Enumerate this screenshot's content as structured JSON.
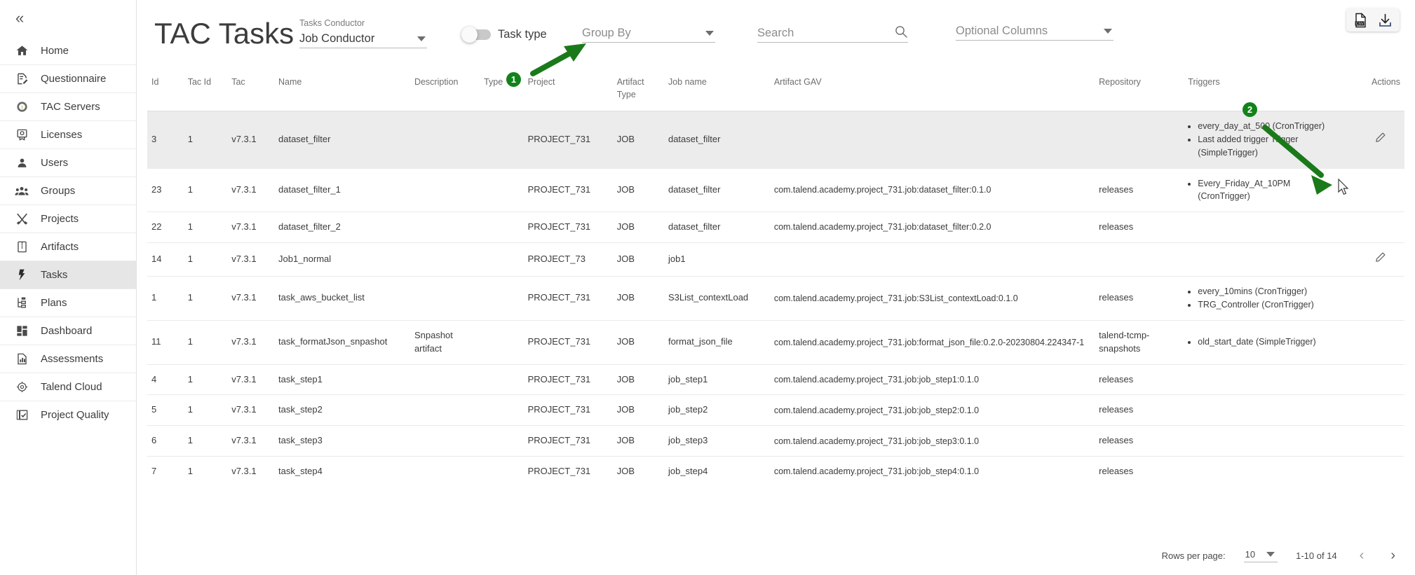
{
  "sidebar": {
    "collapse_icon": "chevrons-left-icon",
    "items": [
      {
        "label": "Home",
        "icon": "home-icon",
        "active": false
      },
      {
        "label": "Questionnaire",
        "icon": "questionnaire-icon",
        "active": false
      },
      {
        "label": "TAC Servers",
        "icon": "tac-servers-icon",
        "active": false
      },
      {
        "label": "Licenses",
        "icon": "license-icon",
        "active": false
      },
      {
        "label": "Users",
        "icon": "user-icon",
        "active": false
      },
      {
        "label": "Groups",
        "icon": "groups-icon",
        "active": false
      },
      {
        "label": "Projects",
        "icon": "projects-icon",
        "active": false
      },
      {
        "label": "Artifacts",
        "icon": "artifacts-icon",
        "active": false
      },
      {
        "label": "Tasks",
        "icon": "tasks-lightning-icon",
        "active": true
      },
      {
        "label": "Plans",
        "icon": "plans-tree-icon",
        "active": false
      },
      {
        "label": "Dashboard",
        "icon": "dashboard-icon",
        "active": false
      },
      {
        "label": "Assessments",
        "icon": "assessments-chart-icon",
        "active": false
      },
      {
        "label": "Talend Cloud",
        "icon": "talend-cloud-icon",
        "active": false
      },
      {
        "label": "Project Quality",
        "icon": "project-quality-icon",
        "active": false
      }
    ]
  },
  "header": {
    "title": "TAC Tasks",
    "conductor": {
      "label": "Tasks Conductor",
      "value": "Job Conductor"
    },
    "task_type": {
      "label": "Task type",
      "on": false
    },
    "group_by": {
      "placeholder": "Group By",
      "value": ""
    },
    "search": {
      "placeholder": "Search",
      "value": "",
      "icon": "search-icon"
    },
    "optional_columns": {
      "placeholder": "Optional Columns",
      "value": ""
    },
    "export_csv_icon": "csv-file-icon",
    "export_download_icon": "download-icon"
  },
  "table": {
    "columns": [
      "Id",
      "Tac Id",
      "Tac",
      "Name",
      "Description",
      "Type",
      "Project",
      "Artifact Type",
      "Job name",
      "Artifact GAV",
      "Repository",
      "Triggers",
      "Actions"
    ],
    "rows": [
      {
        "id": "3",
        "tac_id": "1",
        "tac": "v7.3.1",
        "name": "dataset_filter",
        "description": "",
        "type": "",
        "project": "PROJECT_731",
        "artifact_type": "JOB",
        "job_name": "dataset_filter",
        "gav": "",
        "repository": "",
        "triggers": [
          "every_day_at_500 (CronTrigger)",
          "Last added trigger Trigger (SimpleTrigger)"
        ],
        "has_edit": true,
        "selected": true
      },
      {
        "id": "23",
        "tac_id": "1",
        "tac": "v7.3.1",
        "name": "dataset_filter_1",
        "description": "",
        "type": "",
        "project": "PROJECT_731",
        "artifact_type": "JOB",
        "job_name": "dataset_filter",
        "gav": "com.talend.academy.project_731.job:dataset_filter:0.1.0",
        "repository": "releases",
        "triggers": [
          "Every_Friday_At_10PM (CronTrigger)"
        ],
        "has_edit": false,
        "selected": false
      },
      {
        "id": "22",
        "tac_id": "1",
        "tac": "v7.3.1",
        "name": "dataset_filter_2",
        "description": "",
        "type": "",
        "project": "PROJECT_731",
        "artifact_type": "JOB",
        "job_name": "dataset_filter",
        "gav": "com.talend.academy.project_731.job:dataset_filter:0.2.0",
        "repository": "releases",
        "triggers": [],
        "has_edit": false,
        "selected": false
      },
      {
        "id": "14",
        "tac_id": "1",
        "tac": "v7.3.1",
        "name": "Job1_normal",
        "description": "",
        "type": "",
        "project": "PROJECT_73",
        "artifact_type": "JOB",
        "job_name": "job1",
        "gav": "",
        "repository": "",
        "triggers": [],
        "has_edit": true,
        "selected": false
      },
      {
        "id": "1",
        "tac_id": "1",
        "tac": "v7.3.1",
        "name": "task_aws_bucket_list",
        "description": "",
        "type": "",
        "project": "PROJECT_731",
        "artifact_type": "JOB",
        "job_name": "S3List_contextLoad",
        "gav": "com.talend.academy.project_731.job:S3List_contextLoad:0.1.0",
        "repository": "releases",
        "triggers": [
          "every_10mins (CronTrigger)",
          "TRG_Controller (CronTrigger)"
        ],
        "has_edit": false,
        "selected": false
      },
      {
        "id": "11",
        "tac_id": "1",
        "tac": "v7.3.1",
        "name": "task_formatJson_snpashot",
        "description": "Snpashot artifact",
        "type": "",
        "project": "PROJECT_731",
        "artifact_type": "JOB",
        "job_name": "format_json_file",
        "gav": "com.talend.academy.project_731.job:format_json_file:0.2.0-20230804.224347-1",
        "repository": "talend-tcmp-snapshots",
        "triggers": [
          "old_start_date (SimpleTrigger)"
        ],
        "has_edit": false,
        "selected": false
      },
      {
        "id": "4",
        "tac_id": "1",
        "tac": "v7.3.1",
        "name": "task_step1",
        "description": "",
        "type": "",
        "project": "PROJECT_731",
        "artifact_type": "JOB",
        "job_name": "job_step1",
        "gav": "com.talend.academy.project_731.job:job_step1:0.1.0",
        "repository": "releases",
        "triggers": [],
        "has_edit": false,
        "selected": false
      },
      {
        "id": "5",
        "tac_id": "1",
        "tac": "v7.3.1",
        "name": "task_step2",
        "description": "",
        "type": "",
        "project": "PROJECT_731",
        "artifact_type": "JOB",
        "job_name": "job_step2",
        "gav": "com.talend.academy.project_731.job:job_step2:0.1.0",
        "repository": "releases",
        "triggers": [],
        "has_edit": false,
        "selected": false
      },
      {
        "id": "6",
        "tac_id": "1",
        "tac": "v7.3.1",
        "name": "task_step3",
        "description": "",
        "type": "",
        "project": "PROJECT_731",
        "artifact_type": "JOB",
        "job_name": "job_step3",
        "gav": "com.talend.academy.project_731.job:job_step3:0.1.0",
        "repository": "releases",
        "triggers": [],
        "has_edit": false,
        "selected": false
      },
      {
        "id": "7",
        "tac_id": "1",
        "tac": "v7.3.1",
        "name": "task_step4",
        "description": "",
        "type": "",
        "project": "PROJECT_731",
        "artifact_type": "JOB",
        "job_name": "job_step4",
        "gav": "com.talend.academy.project_731.job:job_step4:0.1.0",
        "repository": "releases",
        "triggers": [],
        "has_edit": false,
        "selected": false
      }
    ]
  },
  "pagination": {
    "rows_per_page_label": "Rows per page:",
    "rows_per_page_value": "10",
    "range_label": "1-10 of 14",
    "prev_icon": "chevron-left-icon",
    "next_icon": "chevron-right-icon"
  },
  "annotations": {
    "marker_1": "1",
    "marker_2": "2",
    "accent_color": "#12821a"
  }
}
